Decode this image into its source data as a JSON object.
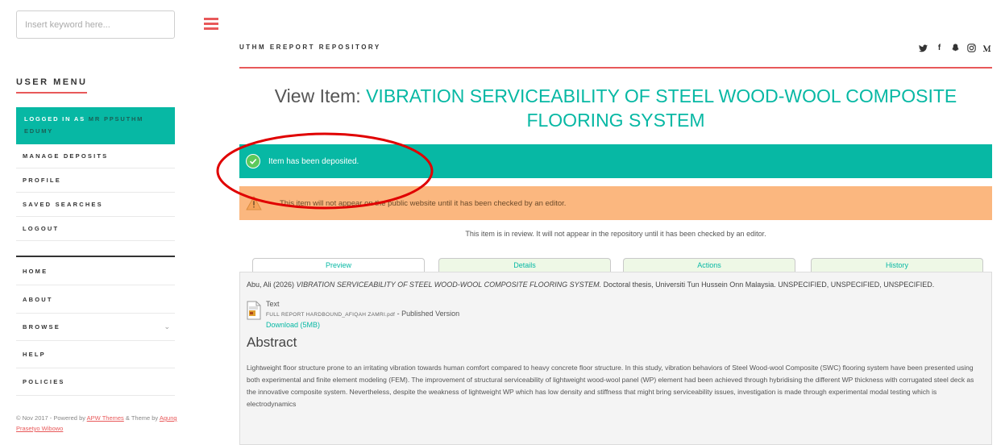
{
  "sidebar": {
    "search_placeholder": "Insert keyword here...",
    "menu_heading": "USER MENU",
    "logged_in_prefix": "LOGGED IN AS ",
    "logged_in_user": "MR PPSUTHM EDUMY",
    "user_items": [
      "MANAGE DEPOSITS",
      "PROFILE",
      "SAVED SEARCHES",
      "LOGOUT"
    ],
    "nav_items": [
      "HOME",
      "ABOUT",
      "BROWSE",
      "HELP",
      "POLICIES"
    ],
    "footer_prefix": "© Nov 2017 - Powered by ",
    "footer_themes": "APW Themes",
    "footer_mid": " & Theme by ",
    "footer_author": "Agung Prasetyo Wibowo"
  },
  "header": {
    "site_name": "UTHM EREPORT REPOSITORY",
    "social_icons": [
      "twitter-icon",
      "facebook-icon",
      "snapchat-icon",
      "instagram-icon",
      "medium-icon"
    ],
    "social_glyphs": [
      "🐦",
      "f",
      "♠",
      "◎",
      "M"
    ]
  },
  "main": {
    "title_prefix": "View Item: ",
    "title_highlight": "VIBRATION SERVICEABILITY OF STEEL WOOD-WOOL COMPOSITE FLOORING SYSTEM",
    "success_message": "Item has been deposited.",
    "warning_message": "This item will not appear on the public website until it has been checked by an editor.",
    "review_note": "This item is in review. It will not appear in the repository until it has been checked by an editor.",
    "tabs": [
      "Preview",
      "Details",
      "Actions",
      "History"
    ],
    "citation": {
      "author": "Abu, Ali",
      "year": " (2026) ",
      "title": "VIBRATION SERVICEABILITY OF STEEL WOOD-WOOL COMPOSITE FLOORING SYSTEM.",
      "rest": " Doctoral thesis, Universiti Tun Hussein Onn Malaysia. UNSPECIFIED, UNSPECIFIED, UNSPECIFIED."
    },
    "document": {
      "type": "Text",
      "filename": "FULL REPORT HARDBOUND_AFIQAH ZAMRI.pdf",
      "version": " - Published Version",
      "download": "Download (5MB)"
    },
    "abstract_heading": "Abstract",
    "abstract_text": "Lightweight floor structure prone to an irritating vibration towards human comfort compared to heavy concrete floor structure. In this study, vibration behaviors of Steel Wood-wool Composite (SWC) flooring system have been presented using both experimental and finite element modeling (FEM). The improvement of structural serviceability of lightweight wood-wool panel (WP) element had been achieved through hybridising the different WP thickness with corrugated steel deck as the innovative composite system. Nevertheless, despite the weakness of lightweight WP which has low density and stiffness that might bring serviceability issues, investigation is made through experimental modal testing which is electrodynamics"
  },
  "colors": {
    "accent_teal": "#07b8a4",
    "accent_red": "#e8595a",
    "warning_orange": "#fbb77f"
  }
}
